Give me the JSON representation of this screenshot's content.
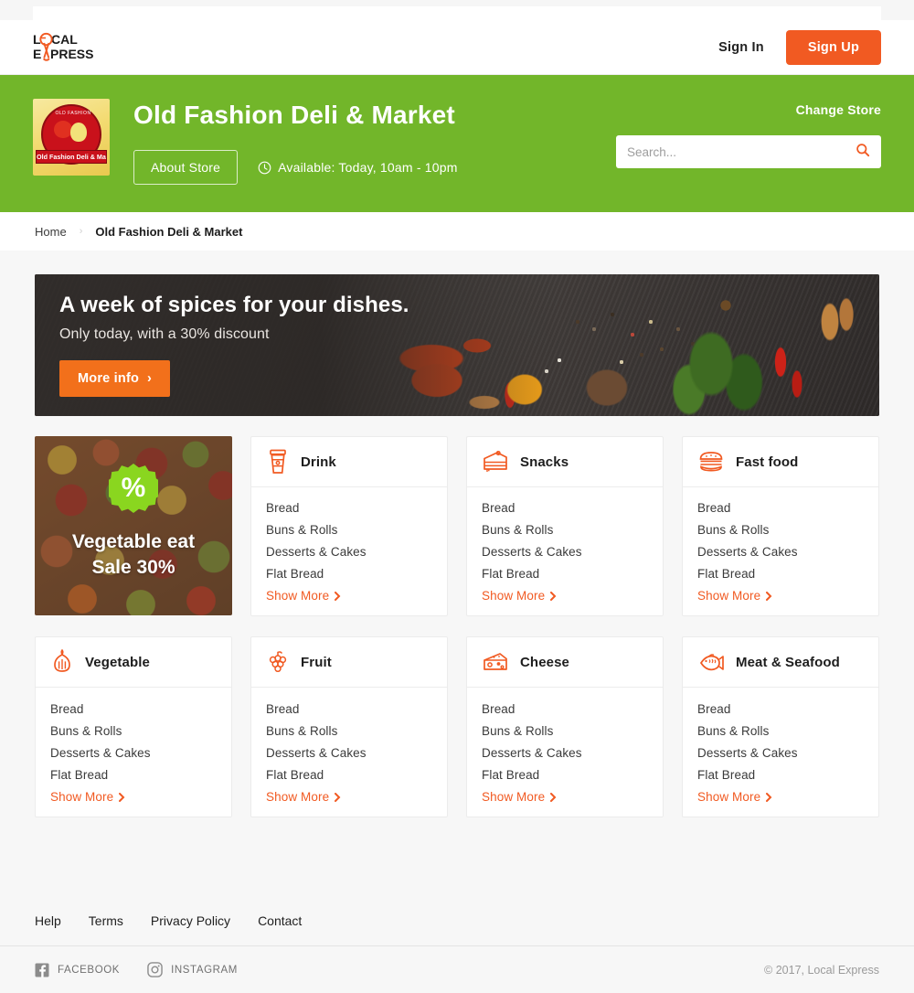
{
  "brand": {
    "logo_line1": "LOCAL",
    "logo_line2": "EXPRESS",
    "accent": "#f15a22",
    "green": "#72b62a"
  },
  "nav": {
    "sign_in": "Sign In",
    "sign_up": "Sign Up"
  },
  "store": {
    "title": "Old Fashion Deli & Market",
    "logo_arc_text": "OLD FASHION",
    "logo_ribbon_text": "Old Fashion Deli & Market",
    "about_button": "About Store",
    "availability": "Available: Today, 10am - 10pm",
    "change_store": "Change Store",
    "search_placeholder": "Search..."
  },
  "breadcrumb": {
    "home": "Home",
    "separator": "›",
    "current": "Old Fashion Deli & Market"
  },
  "hero": {
    "title": "A week of spices for your dishes.",
    "subtitle": "Only today, with a 30% discount",
    "cta": "More info",
    "cta_arrow": "›"
  },
  "promo": {
    "badge": "%",
    "line1": "Vegetable eat",
    "line2": "Sale 30%"
  },
  "categories": [
    {
      "name": "Drink",
      "icon": "coffee-cup-icon",
      "subs": [
        "Bread",
        "Buns & Rolls",
        "Desserts & Cakes",
        "Flat Bread"
      ],
      "more": "Show More"
    },
    {
      "name": "Snacks",
      "icon": "cake-slice-icon",
      "subs": [
        "Bread",
        "Buns & Rolls",
        "Desserts & Cakes",
        "Flat Bread"
      ],
      "more": "Show More"
    },
    {
      "name": "Fast food",
      "icon": "burger-icon",
      "subs": [
        "Bread",
        "Buns & Rolls",
        "Desserts & Cakes",
        "Flat Bread"
      ],
      "more": "Show More"
    },
    {
      "name": "Vegetable",
      "icon": "onion-icon",
      "subs": [
        "Bread",
        "Buns & Rolls",
        "Desserts & Cakes",
        "Flat Bread"
      ],
      "more": "Show More"
    },
    {
      "name": "Fruit",
      "icon": "grapes-icon",
      "subs": [
        "Bread",
        "Buns & Rolls",
        "Desserts & Cakes",
        "Flat Bread"
      ],
      "more": "Show More"
    },
    {
      "name": "Cheese",
      "icon": "cheese-icon",
      "subs": [
        "Bread",
        "Buns & Rolls",
        "Desserts & Cakes",
        "Flat Bread"
      ],
      "more": "Show More"
    },
    {
      "name": "Meat & Seafood",
      "icon": "fish-icon",
      "subs": [
        "Bread",
        "Buns & Rolls",
        "Desserts & Cakes",
        "Flat Bread"
      ],
      "more": "Show More"
    }
  ],
  "footer": {
    "links": [
      "Help",
      "Terms",
      "Privacy Policy",
      "Contact"
    ],
    "socials": [
      {
        "label": "FACEBOOK",
        "icon": "facebook-icon"
      },
      {
        "label": "INSTAGRAM",
        "icon": "instagram-icon"
      }
    ],
    "copyright": "© 2017, Local Express"
  }
}
